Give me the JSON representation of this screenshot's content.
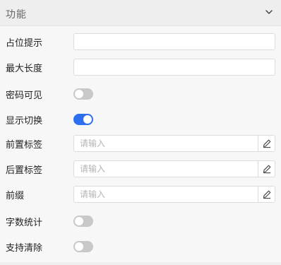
{
  "section": {
    "title": "功能",
    "expanded": true
  },
  "fields": {
    "placeholder_hint": {
      "label": "占位提示",
      "value": ""
    },
    "max_length": {
      "label": "最大长度",
      "value": ""
    },
    "password_visible": {
      "label": "密码可见",
      "on": false
    },
    "show_toggle": {
      "label": "显示切换",
      "on": true
    },
    "prefix_tag": {
      "label": "前置标签",
      "placeholder": "请输入",
      "value": ""
    },
    "suffix_tag": {
      "label": "后置标签",
      "placeholder": "请输入",
      "value": ""
    },
    "prefix": {
      "label": "前缀",
      "placeholder": "请输入",
      "value": ""
    },
    "word_count": {
      "label": "字数统计",
      "on": false
    },
    "clearable": {
      "label": "支持清除",
      "on": false
    }
  },
  "icons": {
    "collapse": "chevron-down-icon",
    "edit": "pencil-icon"
  },
  "colors": {
    "accent": "#2e6fef",
    "switch_off": "#c8c8c8"
  }
}
